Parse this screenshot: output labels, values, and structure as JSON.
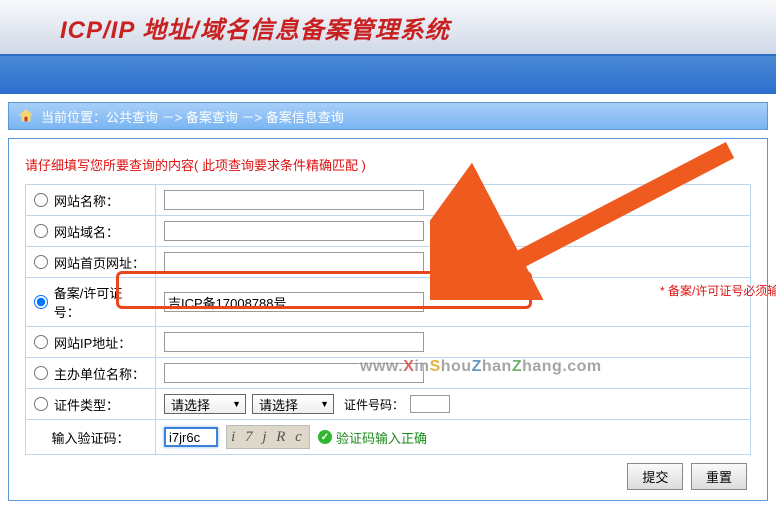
{
  "header": {
    "title": "ICP/IP 地址/域名信息备案管理系统"
  },
  "breadcrumb": {
    "prefix": "当前位置：",
    "l1": "公共查询",
    "l2": "备案查询",
    "l3": "备案信息查询",
    "sep": " －> "
  },
  "form": {
    "instruction": "请仔细填写您所要查询的内容( 此项查询要求条件精确匹配 )",
    "rows": {
      "site_name": "网站名称：",
      "site_domain": "网站域名：",
      "site_home_url": "网站首页网址：",
      "record_license": "备案/许可证号：",
      "site_ip": "网站IP地址：",
      "sponsor_name": "主办单位名称：",
      "cert_type": "证件类型：",
      "captcha_label": "输入验证码："
    },
    "values": {
      "record_license": "吉ICP备17008788号",
      "captcha": "i7jr6c"
    },
    "select_placeholder": "请选择",
    "cert_num_label": "证件号码：",
    "required_note": "* 备案/许可证号必须输入",
    "captcha_ok": "验证码输入正确",
    "captcha_img_text": "i 7 j R c"
  },
  "buttons": {
    "submit": "提交",
    "reset": "重置"
  },
  "watermark": "www.XinShouZhanZhang.com"
}
